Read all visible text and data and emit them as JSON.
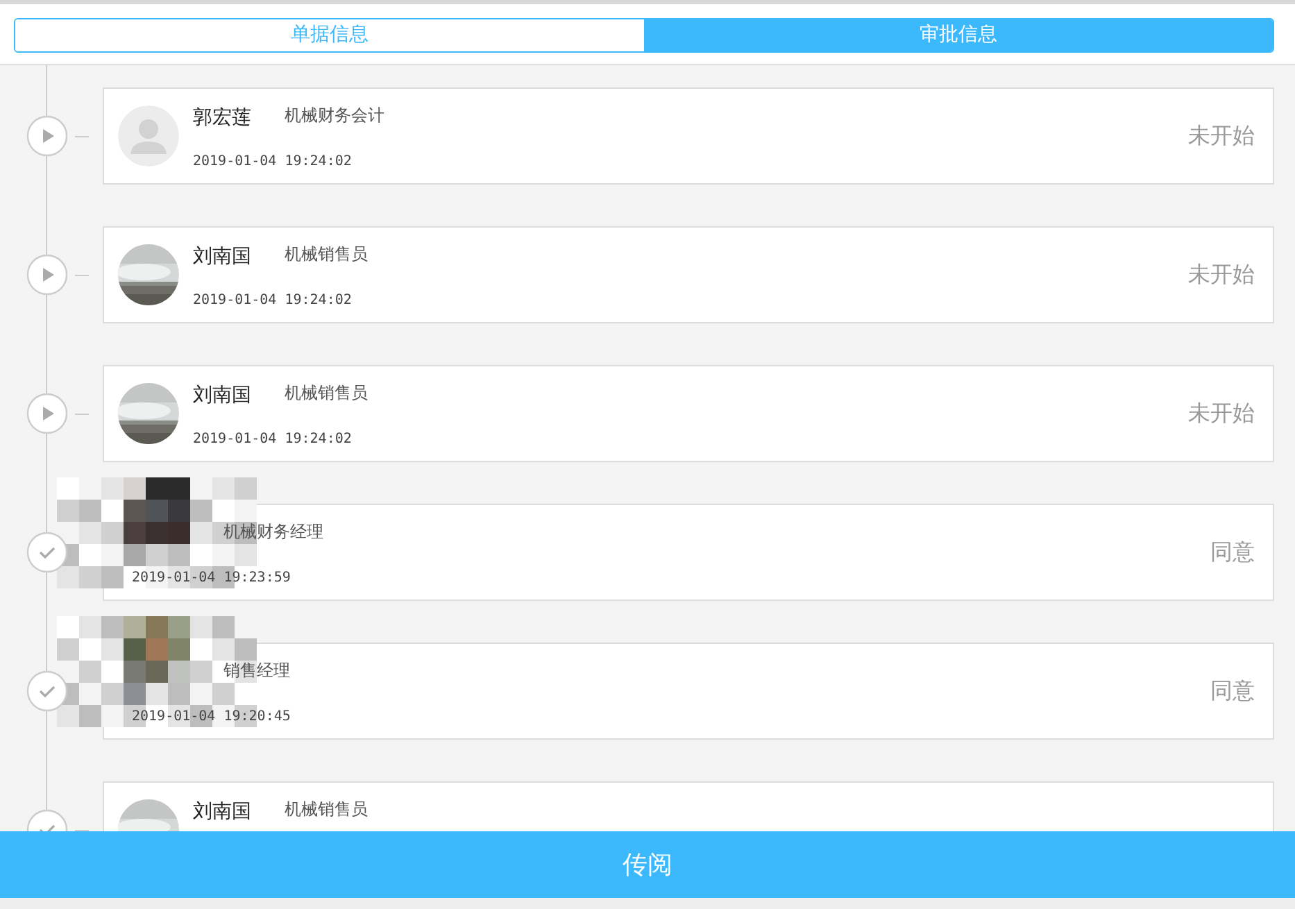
{
  "tabs": [
    {
      "label": "单据信息",
      "selected": false
    },
    {
      "label": "审批信息",
      "selected": true
    }
  ],
  "steps": [
    {
      "kind": "pending",
      "avatar": {
        "kind": "default"
      },
      "name": "郭宏莲",
      "role": "机械财务会计",
      "time": "2019-01-04 19:24:02",
      "result": "未开始"
    },
    {
      "kind": "pending",
      "name": "刘南国",
      "role": "机械销售员",
      "time": "2019-01-04 19:24:02",
      "result": "未开始"
    },
    {
      "kind": "pending",
      "name": "刘南国",
      "role": "机械销售员",
      "time": "2019-01-04 19:24:02",
      "result": "未开始"
    },
    {
      "kind": "approved",
      "avatar": {
        "kind": "pixelated"
      },
      "role": "机械财务经理",
      "time": "2019-01-04 19:23:59",
      "result": "同意"
    },
    {
      "kind": "approved",
      "avatar": {
        "kind": "pixelated"
      },
      "role": "销售经理",
      "time": "2019-01-04 19:20:45",
      "result": "同意"
    },
    {
      "kind": "approved",
      "name": "刘南国",
      "role": "机械销售员"
    }
  ],
  "footer_button": "传阅"
}
